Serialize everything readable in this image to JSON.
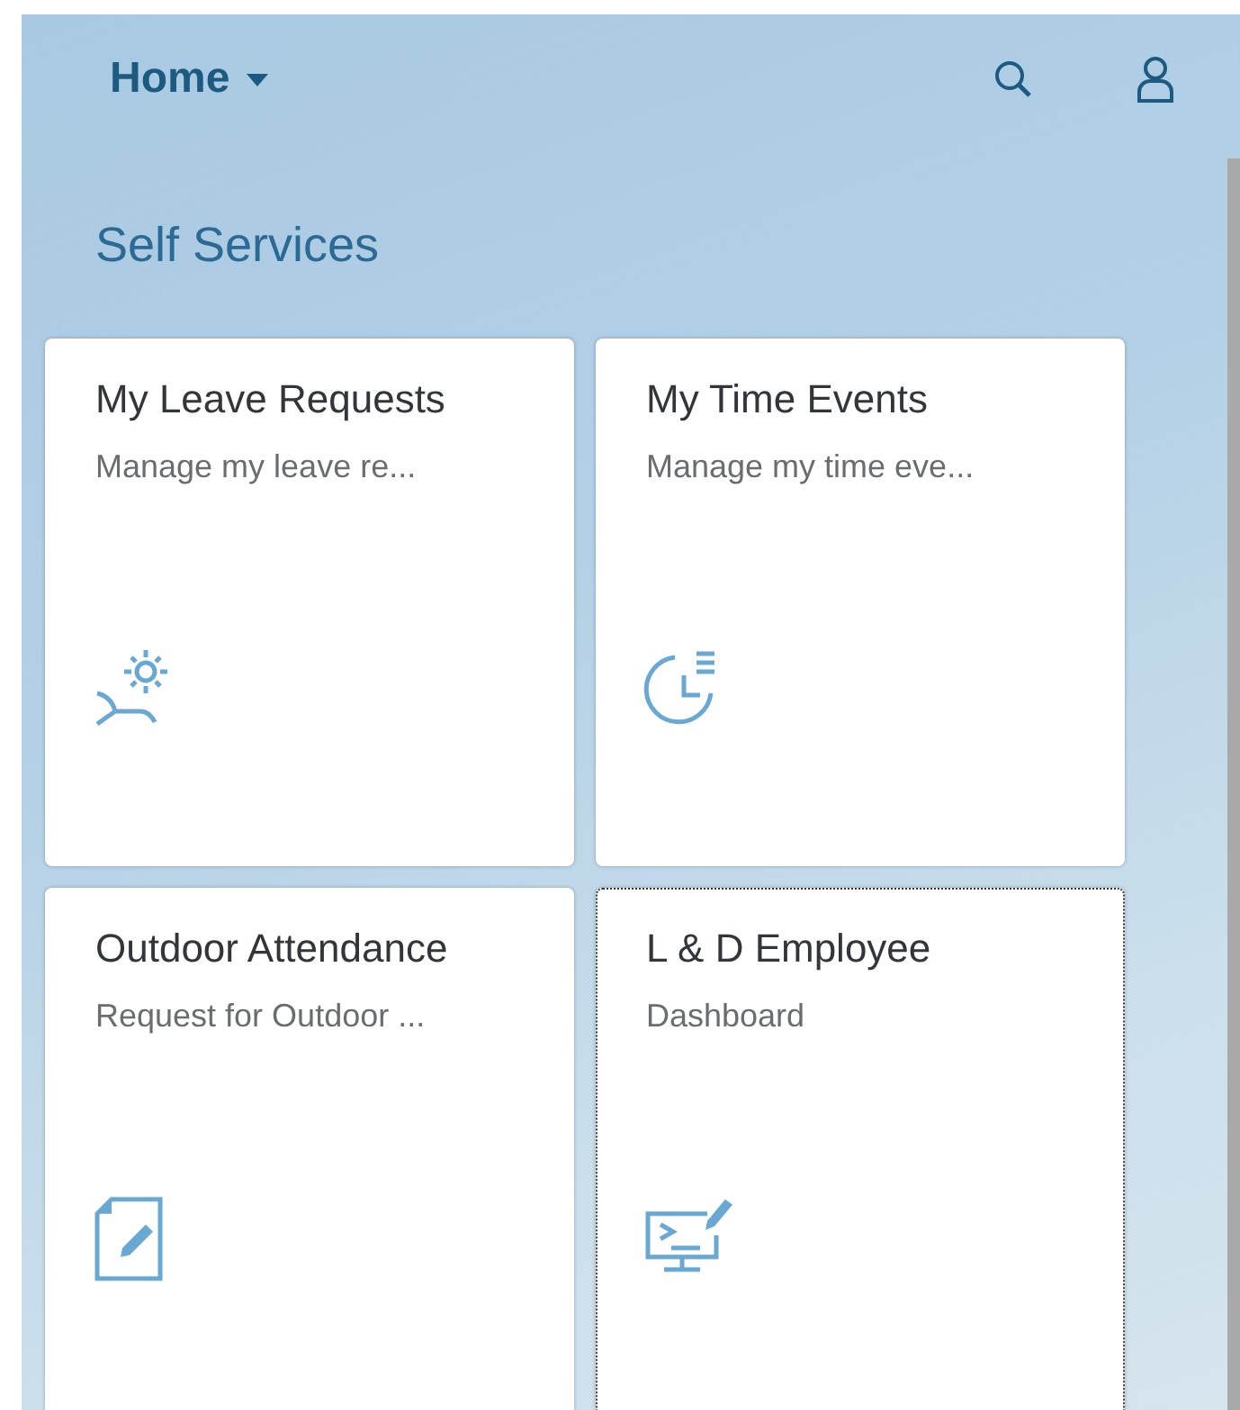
{
  "header": {
    "title": "Home"
  },
  "group": {
    "title": "Self Services"
  },
  "tiles": [
    {
      "title": "My Leave Requests",
      "subtitle": "Manage my leave re...",
      "focused": false
    },
    {
      "title": "My Time Events",
      "subtitle": "Manage my time eve...",
      "focused": false
    },
    {
      "title": "Outdoor Attendance",
      "subtitle": "Request for Outdoor ...",
      "focused": false
    },
    {
      "title": "L & D Employee",
      "subtitle": "Dashboard",
      "focused": true
    }
  ]
}
